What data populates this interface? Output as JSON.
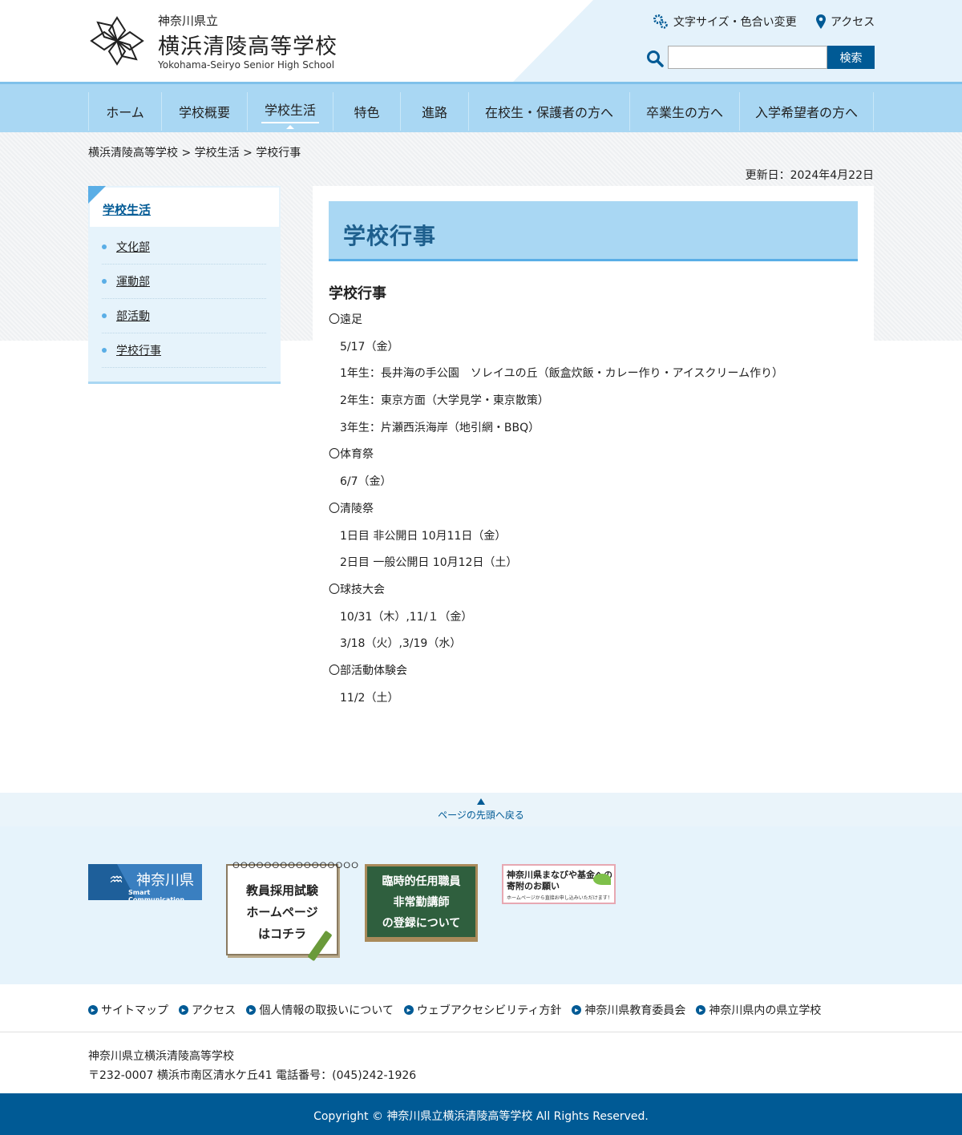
{
  "header": {
    "prefecture": "神奈川県立",
    "school_name": "横浜清陵高等学校",
    "school_name_en": "Yokohama-Seiryo Senior High School",
    "font_color_link": "文字サイズ・色合い変更",
    "access_link": "アクセス",
    "search_placeholder": "",
    "search_button": "検索"
  },
  "nav": {
    "items": [
      "ホーム",
      "学校概要",
      "学校生活",
      "特色",
      "進路",
      "在校生・保護者の方へ",
      "卒業生の方へ",
      "入学希望者の方へ"
    ],
    "active": "学校生活"
  },
  "breadcrumb": "横浜清陵高等学校 > 学校生活 > 学校行事",
  "updated": "更新日：2024年4月22日",
  "side": {
    "title": "学校生活",
    "items": [
      "文化部",
      "運動部",
      "部活動",
      "学校行事"
    ]
  },
  "main": {
    "title": "学校行事",
    "section_heading": "学校行事",
    "lines": [
      "〇遠足",
      "5/17（金）",
      "1年生：長井海の手公園　ソレイユの丘（飯盒炊飯・カレー作り・アイスクリーム作り）",
      "2年生：東京方面（大学見学・東京散策）",
      "3年生：片瀬西浜海岸（地引網・BBQ）",
      "〇体育祭",
      "6/7（金）",
      "〇清陵祭",
      "1日目 非公開日 10月11日（金）",
      "2日目 一般公開日 10月12日（土）",
      "〇球技大会",
      "10/31（木）,11/１（金）",
      "3/18（火）,3/19（水）",
      "〇部活動体験会",
      "11/2（土）"
    ]
  },
  "page_top": "ページの先頭へ戻る",
  "banners": {
    "kanagawa": {
      "title": "神奈川県",
      "sub": "Smart Communication"
    },
    "recruit": {
      "lines": [
        "教員採用試験",
        "ホームページ",
        "はコチラ"
      ]
    },
    "temp_staff": {
      "lines": [
        "臨時的任用職員",
        "非常勤講師",
        "の登録について"
      ]
    },
    "manabiya": {
      "line1": "神奈川県まなびや基金への",
      "line2": "寄附のお願い",
      "line3": "ホームページから直接お申し込みいただけます！"
    }
  },
  "footer": {
    "links": [
      "サイトマップ",
      "アクセス",
      "個人情報の取扱いについて",
      "ウェブアクセシビリティ方針",
      "神奈川県教育委員会",
      "神奈川県内の県立学校"
    ],
    "address_name": "神奈川県立横浜清陵高等学校",
    "address_line": "〒232-0007 横浜市南区清水ケ丘41 電話番号：(045)242-1926",
    "copyright": "Copyright © 神奈川県立横浜清陵高等学校 All Rights Reserved."
  },
  "colors": {
    "brand": "#005a95",
    "nav": "#a9d7f3",
    "accent": "#5aaee6"
  }
}
